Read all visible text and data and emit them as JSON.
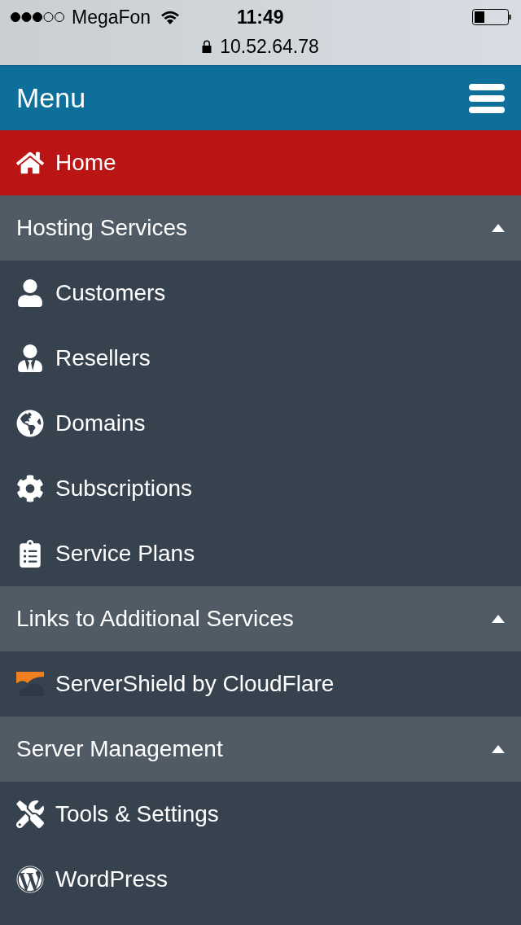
{
  "status_bar": {
    "carrier": "MegaFon",
    "time": "11:49"
  },
  "address_bar": {
    "url": "10.52.64.78"
  },
  "header": {
    "title": "Menu"
  },
  "menu": [
    {
      "kind": "link",
      "label": "Home",
      "selected": true
    },
    {
      "kind": "section",
      "label": "Hosting Services",
      "expanded": true,
      "children": [
        {
          "label": "Customers",
          "selected": false
        },
        {
          "label": "Resellers",
          "selected": false
        },
        {
          "label": "Domains",
          "selected": false
        },
        {
          "label": "Subscriptions",
          "selected": false
        },
        {
          "label": "Service Plans",
          "selected": false
        }
      ]
    },
    {
      "kind": "section",
      "label": "Links to Additional Services",
      "expanded": true,
      "children": [
        {
          "label": "ServerShield by CloudFlare",
          "selected": false
        }
      ]
    },
    {
      "kind": "section",
      "label": "Server Management",
      "expanded": true,
      "children": [
        {
          "label": "Tools & Settings",
          "selected": false
        },
        {
          "label": "WordPress",
          "selected": false
        }
      ]
    }
  ]
}
